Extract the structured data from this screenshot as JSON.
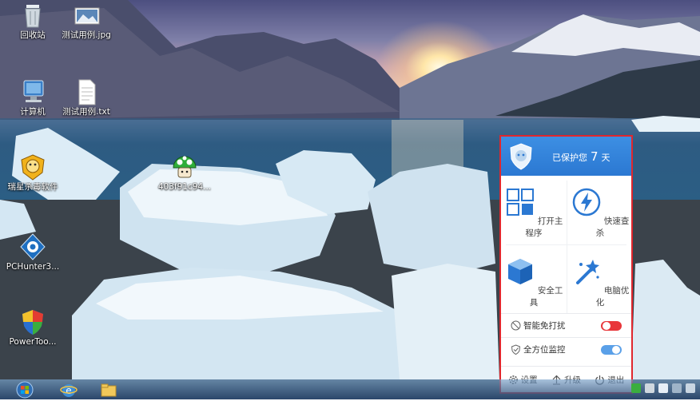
{
  "desktop": {
    "icons": [
      {
        "label": "回收站",
        "icon": "recycle-bin-icon"
      },
      {
        "label": "测试用例.jpg",
        "icon": "image-file-icon"
      },
      {
        "label": "计算机",
        "icon": "computer-icon"
      },
      {
        "label": "测试用例.txt",
        "icon": "text-file-icon"
      },
      {
        "label": "瑞星杀毒软件",
        "icon": "rising-antivirus-icon"
      },
      {
        "label": "403f91c94...",
        "icon": "green-mushroom-icon"
      },
      {
        "label": "PCHunter3...",
        "icon": "pchunter-icon"
      },
      {
        "label": "PowerToo...",
        "icon": "powertool-shield-icon"
      }
    ]
  },
  "panel": {
    "protect_prefix": "已保护您",
    "protect_days": "7",
    "protect_suffix": "天",
    "tiles": [
      {
        "label": "打开主程序",
        "icon": "grid-icon"
      },
      {
        "label": "快速查杀",
        "icon": "lightning-icon"
      },
      {
        "label": "安全工具",
        "icon": "cube-icon"
      },
      {
        "label": "电脑优化",
        "icon": "magic-wand-icon"
      }
    ],
    "options": [
      {
        "label": "智能免打扰",
        "state": "off",
        "color": "#e8363a"
      },
      {
        "label": "全方位监控",
        "state": "on",
        "color": "#5aa0e8"
      }
    ],
    "footer": {
      "settings": "设置",
      "upgrade": "升级",
      "exit": "退出"
    },
    "accent": "#2b78d2",
    "highlight_border": "#e0272d"
  }
}
